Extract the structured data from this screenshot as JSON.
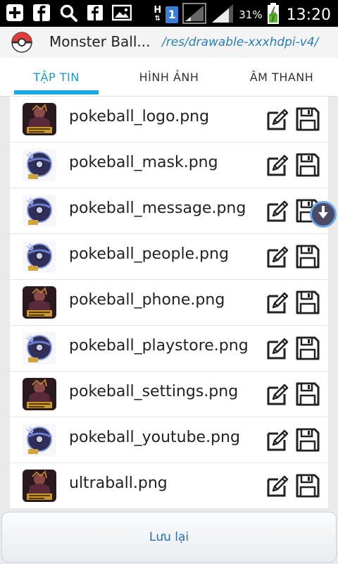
{
  "status_bar": {
    "notification_icons": [
      "add-box-icon",
      "facebook-icon",
      "search-icon",
      "facebook-icon",
      "image-icon"
    ],
    "data_indicator": "H",
    "sim_badge": "1",
    "battery_percent": "31%",
    "time": "13:20"
  },
  "appbar": {
    "title": "Monster Ball...",
    "path": "/res/drawable-xxxhdpi-v4/"
  },
  "tabs": [
    {
      "label": "TẬP TIN",
      "active": true
    },
    {
      "label": "HÌNH ẢNH",
      "active": false
    },
    {
      "label": "ÂM THANH",
      "active": false
    }
  ],
  "files": [
    {
      "name": "pokeball_logo.png",
      "thumb": "poster"
    },
    {
      "name": "pokeball_mask.png",
      "thumb": "ball"
    },
    {
      "name": "pokeball_message.png",
      "thumb": "ball"
    },
    {
      "name": "pokeball_people.png",
      "thumb": "ball"
    },
    {
      "name": "pokeball_phone.png",
      "thumb": "poster"
    },
    {
      "name": "pokeball_playstore.png",
      "thumb": "ball"
    },
    {
      "name": "pokeball_settings.png",
      "thumb": "poster"
    },
    {
      "name": "pokeball_youtube.png",
      "thumb": "ball"
    },
    {
      "name": "ultraball.png",
      "thumb": "poster"
    }
  ],
  "bottom_button": {
    "label": "Lưu lại"
  },
  "colors": {
    "accent": "#1aa6e2",
    "path_text": "#2a7fb5",
    "button_text": "#2a6fa8"
  }
}
